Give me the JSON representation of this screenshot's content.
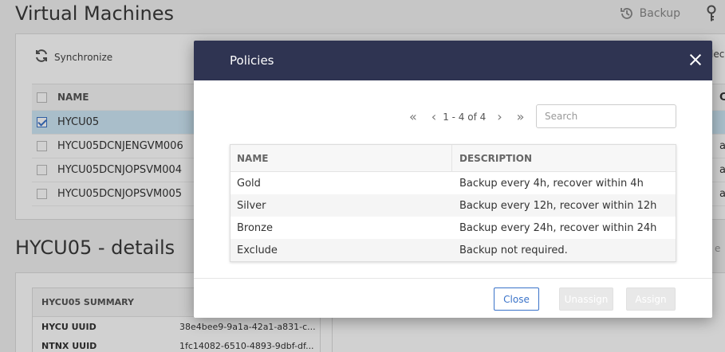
{
  "background": {
    "page_title": "Virtual Machines",
    "top_actions": {
      "backup_label": "Backup"
    },
    "vm_panel": {
      "synchronize_label": "Synchronize",
      "right_cut_label": "lec",
      "columns": {
        "name": "NAME",
        "right_cut": "C"
      },
      "rows": [
        {
          "name": "HYCU05",
          "checked": true,
          "cut": ""
        },
        {
          "name": "HYCU05DCNJENGVM006",
          "checked": false,
          "cut": "a"
        },
        {
          "name": "HYCU05DCNJOPSVM004",
          "checked": false,
          "cut": "a"
        },
        {
          "name": "HYCU05DCNJOPSVM005",
          "checked": false,
          "cut": "a"
        }
      ]
    },
    "details": {
      "title": "HYCU05 - details",
      "right_cut": "e",
      "summary_header": "HYCU05 SUMMARY",
      "rows": [
        {
          "key": "HYCU UUID",
          "value": "38e4bee9-9a1a-42a1-a831-c..."
        },
        {
          "key": "NTNX UUID",
          "value": "1fc14082-6510-4893-9dbf-df..."
        }
      ]
    }
  },
  "modal": {
    "title": "Policies",
    "pager": {
      "info": "1 - 4 of 4"
    },
    "search": {
      "placeholder": "Search",
      "value": ""
    },
    "columns": {
      "name": "NAME",
      "description": "DESCRIPTION"
    },
    "policies": [
      {
        "name": "Gold",
        "description": "Backup every 4h, recover within 4h"
      },
      {
        "name": "Silver",
        "description": "Backup every 12h, recover within 12h"
      },
      {
        "name": "Bronze",
        "description": "Backup every 24h, recover within 24h"
      },
      {
        "name": "Exclude",
        "description": "Backup not required."
      }
    ],
    "buttons": {
      "close": "Close",
      "unassign": "Unassign",
      "assign": "Assign"
    }
  },
  "colors": {
    "modal_header": "#2f3452",
    "accent": "#3a73c9",
    "selected_row": "#cfe8f7",
    "disabled_button": "#e8e8e8"
  },
  "icons": {
    "synchronize": "refresh-icon",
    "backup": "backup-history-icon",
    "key": "key-icon",
    "close": "close-icon",
    "first": "first-page-icon",
    "prev": "prev-page-icon",
    "next": "next-page-icon",
    "last": "last-page-icon"
  }
}
